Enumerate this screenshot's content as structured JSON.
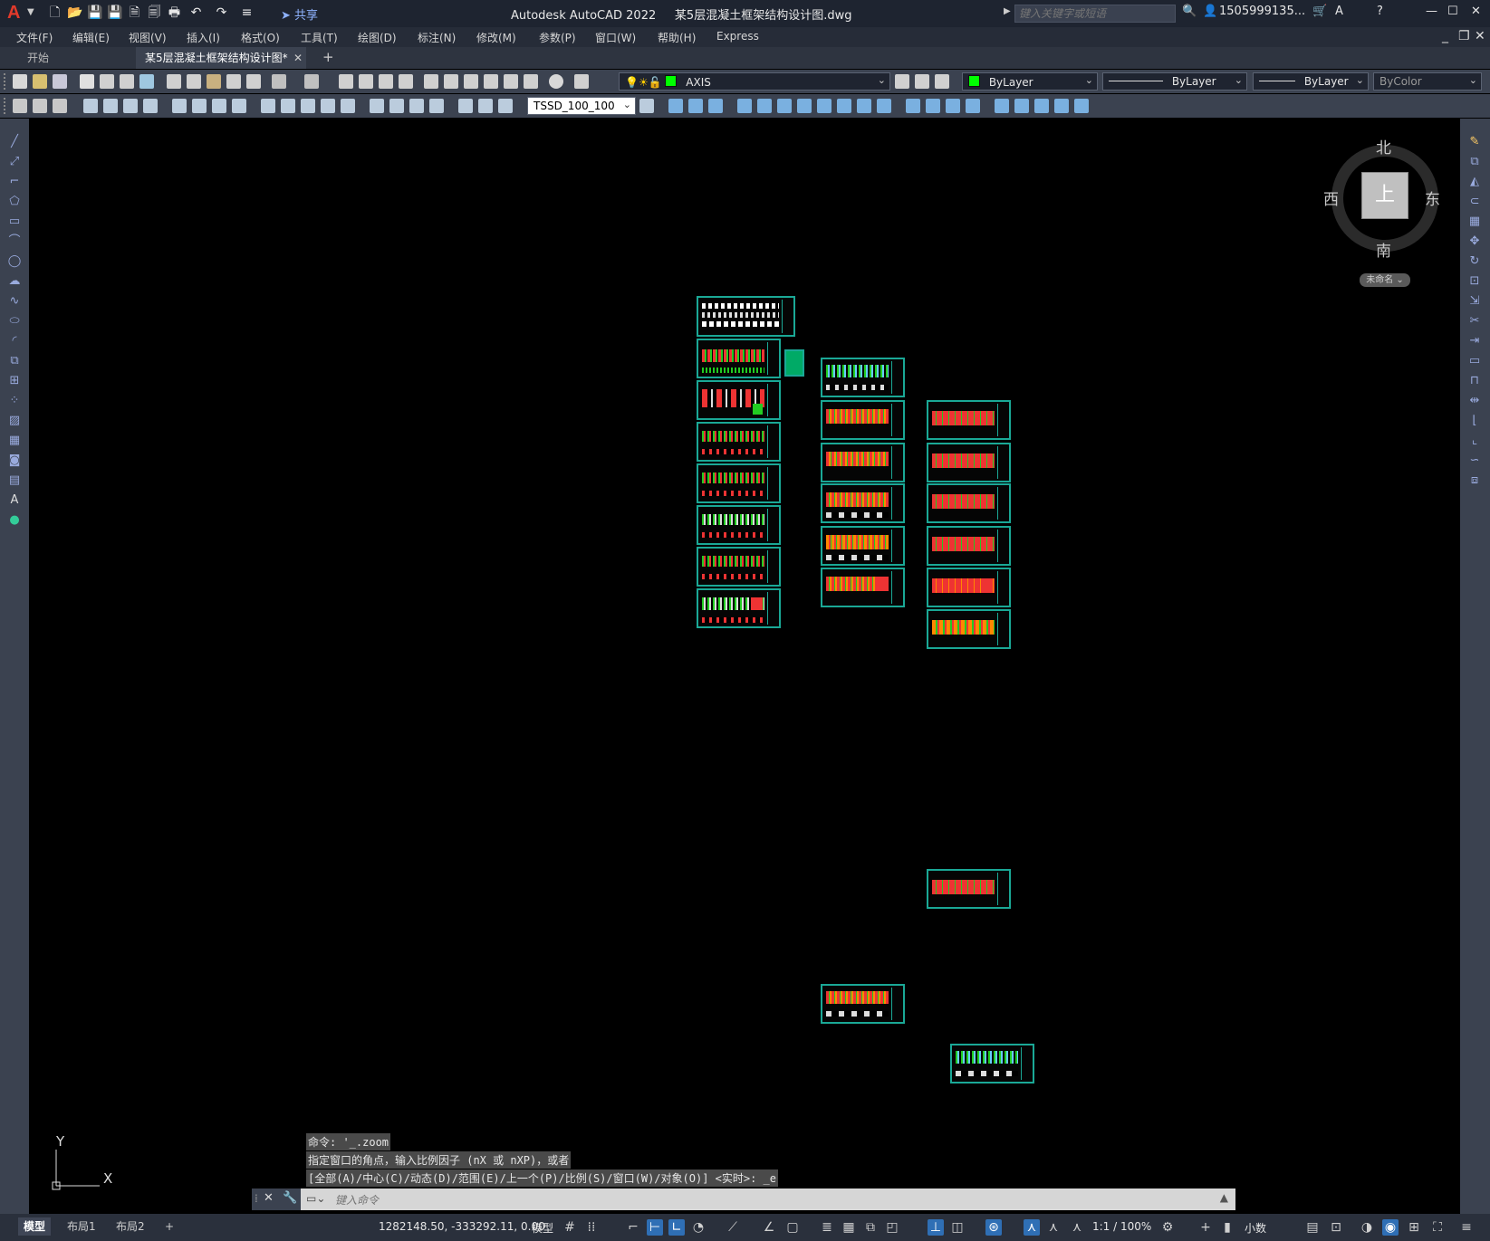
{
  "titlebar": {
    "app_name": "Autodesk AutoCAD 2022",
    "document": "某5层混凝土框架结构设计图.dwg",
    "share_label": "共享",
    "search_placeholder": "键入关键字或短语",
    "user": "1505999135...",
    "logo_letter": "A"
  },
  "menubar": {
    "items": [
      "文件(F)",
      "编辑(E)",
      "视图(V)",
      "插入(I)",
      "格式(O)",
      "工具(T)",
      "绘图(D)",
      "标注(N)",
      "修改(M)",
      "参数(P)",
      "窗口(W)",
      "帮助(H)",
      "Express"
    ]
  },
  "tabs": {
    "start": "开始",
    "document": "某5层混凝土框架结构设计图*",
    "add": "+"
  },
  "toolbar": {
    "layer": "AXIS",
    "color": "ByLayer",
    "linetype": "ByLayer",
    "lineweight": "ByLayer",
    "plotstyle": "ByColor",
    "dimstyle": "TSSD_100_100"
  },
  "viewcube": {
    "north": "北",
    "south": "南",
    "east": "东",
    "west": "西",
    "face": "上",
    "ucs_menu": "未命名"
  },
  "ucs_icon": {
    "x_label": "X",
    "y_label": "Y"
  },
  "command": {
    "history": [
      "命令: '_.zoom",
      "指定窗口的角点，输入比例因子 (nX 或 nXP)，或者",
      "[全部(A)/中心(C)/动态(D)/范围(E)/上一个(P)/比例(S)/窗口(W)/对象(O)] <实时>: _e"
    ],
    "placeholder": "键入命令"
  },
  "statusbar": {
    "layout_tabs": [
      "模型",
      "布局1",
      "布局2"
    ],
    "coordinates": "1282148.50, -333292.11, 0.00",
    "model_label": "模型",
    "scale": "1:1 / 100%",
    "units": "小数"
  },
  "colors": {
    "sheet_border": "#1aa896",
    "canvas": "#000000",
    "layer_swatch": "#00ff00"
  }
}
